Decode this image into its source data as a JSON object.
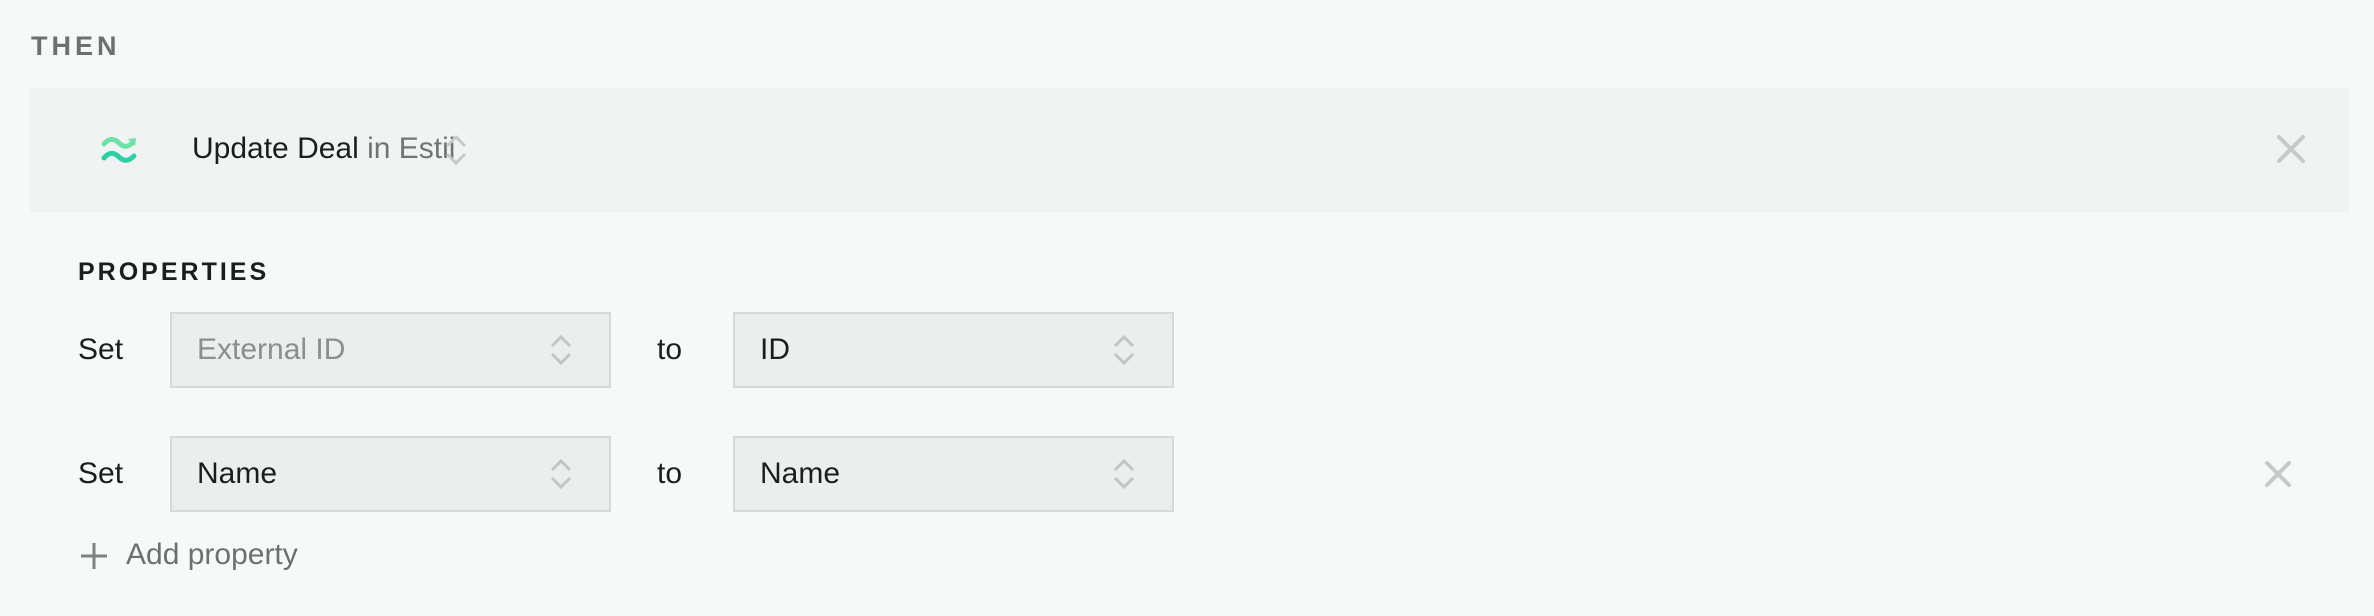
{
  "section_label": "THEN",
  "action": {
    "icon": "estii-wave-icon",
    "verb": "Update Deal",
    "app_text": " in Estii",
    "colors": {
      "icon_top": "#6fe2aa",
      "icon_bottom": "#2ad0a6"
    }
  },
  "properties": {
    "label": "PROPERTIES",
    "rows": [
      {
        "set_label": "Set",
        "field": "External ID",
        "field_is_placeholder": true,
        "to_label": "to",
        "value": "ID",
        "removable": false
      },
      {
        "set_label": "Set",
        "field": "Name",
        "field_is_placeholder": false,
        "to_label": "to",
        "value": "Name",
        "removable": true
      }
    ],
    "add_label": "Add property"
  }
}
